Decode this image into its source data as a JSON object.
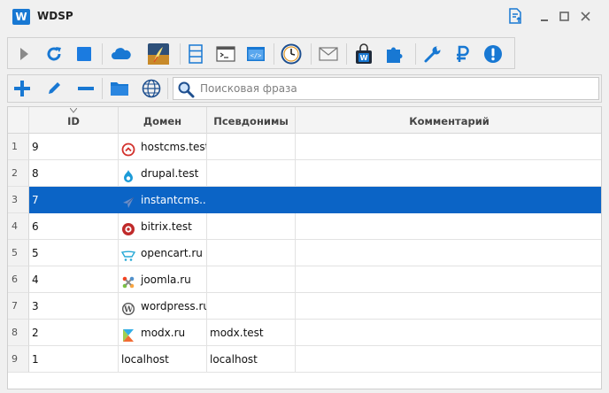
{
  "app": {
    "logo": "W",
    "title": "WDSP"
  },
  "search": {
    "placeholder": "Поисковая фраза"
  },
  "columns": {
    "num": "",
    "id": "ID",
    "domain": "Домен",
    "aliases": "Псевдонимы",
    "comment": "Комментарий"
  },
  "rows": [
    {
      "num": "1",
      "id": "9",
      "domain": "hostcms.test",
      "aliases": "",
      "comment": "",
      "icon": "hostcms-icon"
    },
    {
      "num": "2",
      "id": "8",
      "domain": "drupal.test",
      "aliases": "",
      "comment": "",
      "icon": "drupal-icon"
    },
    {
      "num": "3",
      "id": "7",
      "domain": "instantcms....",
      "aliases": "",
      "comment": "",
      "icon": "instantcms-icon",
      "selected": true
    },
    {
      "num": "4",
      "id": "6",
      "domain": "bitrix.test",
      "aliases": "",
      "comment": "",
      "icon": "bitrix-icon"
    },
    {
      "num": "5",
      "id": "5",
      "domain": "opencart.ru",
      "aliases": "",
      "comment": "",
      "icon": "opencart-icon"
    },
    {
      "num": "6",
      "id": "4",
      "domain": "joomla.ru",
      "aliases": "",
      "comment": "",
      "icon": "joomla-icon"
    },
    {
      "num": "7",
      "id": "3",
      "domain": "wordpress.ru",
      "aliases": "",
      "comment": "",
      "icon": "wordpress-icon"
    },
    {
      "num": "8",
      "id": "2",
      "domain": "modx.ru",
      "aliases": "modx.test",
      "comment": "",
      "icon": "modx-icon"
    },
    {
      "num": "9",
      "id": "1",
      "domain": "localhost",
      "aliases": "localhost",
      "comment": "",
      "icon": ""
    }
  ],
  "colors": {
    "accent": "#1878d3",
    "selection": "#0b64c6",
    "stop": "#1b7be0",
    "danger": "#d2302b"
  }
}
